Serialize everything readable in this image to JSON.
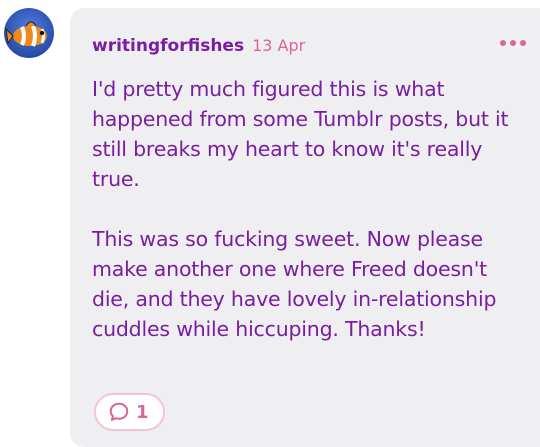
{
  "comment": {
    "author": "writingforfishes",
    "date": "13 Apr",
    "paragraphs": [
      "I'd pretty much figured this is what happened from some Tumblr posts, but it still breaks my heart to know it's really true.",
      "This was so fucking sweet. Now please make another one where Freed doesn't die, and they have lovely in-relationship cuddles while hiccuping. Thanks!"
    ],
    "reply_count": "1"
  },
  "icons": {
    "avatar": "clownfish-avatar",
    "more": "more-options-icon",
    "reply": "speech-bubble-icon"
  },
  "colors": {
    "accent": "#7a1da0",
    "pink": "#d8669d",
    "bubble_bg": "#efeff1"
  }
}
